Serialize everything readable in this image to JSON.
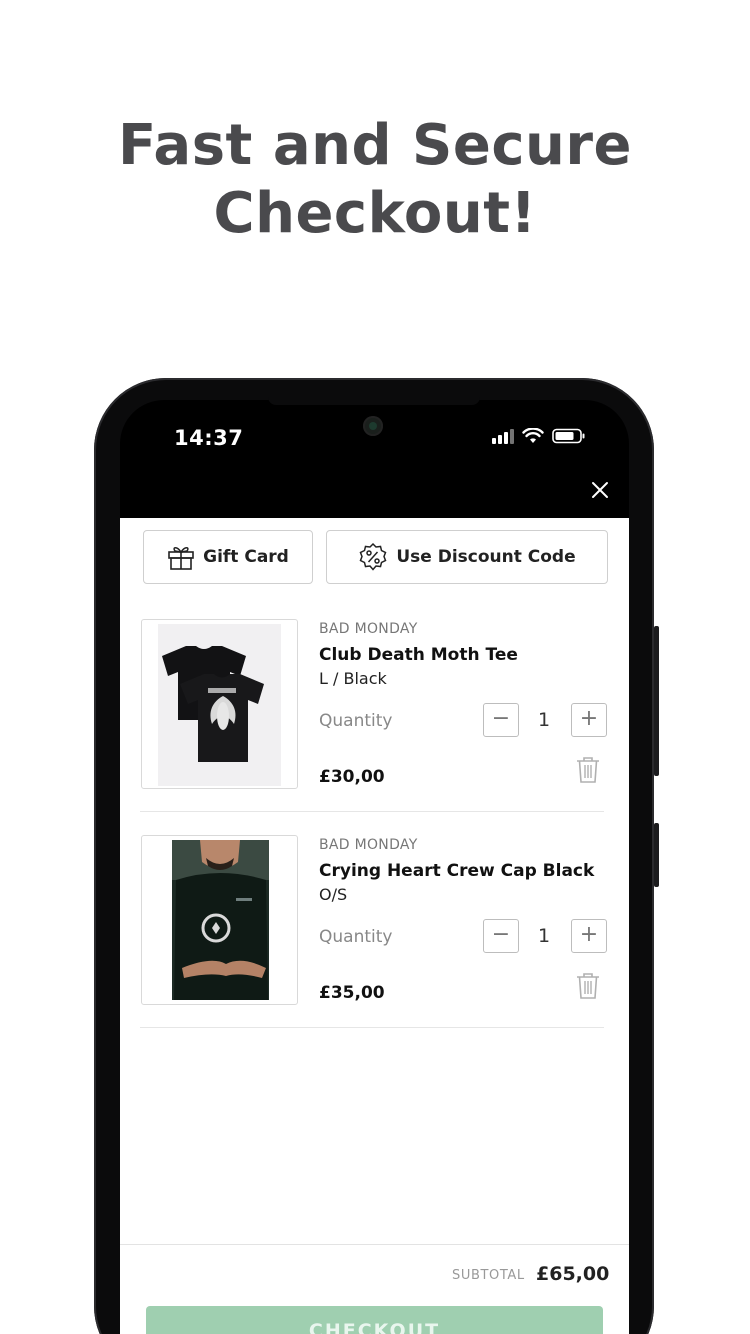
{
  "headline": {
    "line1": "Fast and Secure",
    "line2": "Checkout!"
  },
  "status_bar": {
    "time": "14:37"
  },
  "actions": {
    "gift_card": "Gift Card",
    "discount": "Use Discount Code"
  },
  "cart": {
    "items": [
      {
        "brand": "BAD MONDAY",
        "name": "Club Death Moth Tee",
        "variant": "L / Black",
        "quantity_label": "Quantity",
        "quantity": "1",
        "price": "£30,00",
        "image": "black-tshirt-image"
      },
      {
        "brand": "BAD MONDAY",
        "name": "Crying Heart Crew Cap Black",
        "variant": "O/S",
        "quantity_label": "Quantity",
        "quantity": "1",
        "price": "£35,00",
        "image": "person-in-black-shirt-image"
      }
    ],
    "subtotal_label": "SUBTOTAL",
    "subtotal": "£65,00",
    "checkout_label": "CHECKOUT"
  },
  "colors": {
    "headline": "#4a4a4d",
    "checkout_button": "#9fcfb0",
    "phone_frame": "#0b0b0c"
  },
  "icons": [
    "gift-icon",
    "discount-percent-icon",
    "close-icon",
    "trash-icon",
    "minus-icon",
    "plus-icon",
    "wifi-icon",
    "battery-icon",
    "signal-icon"
  ]
}
